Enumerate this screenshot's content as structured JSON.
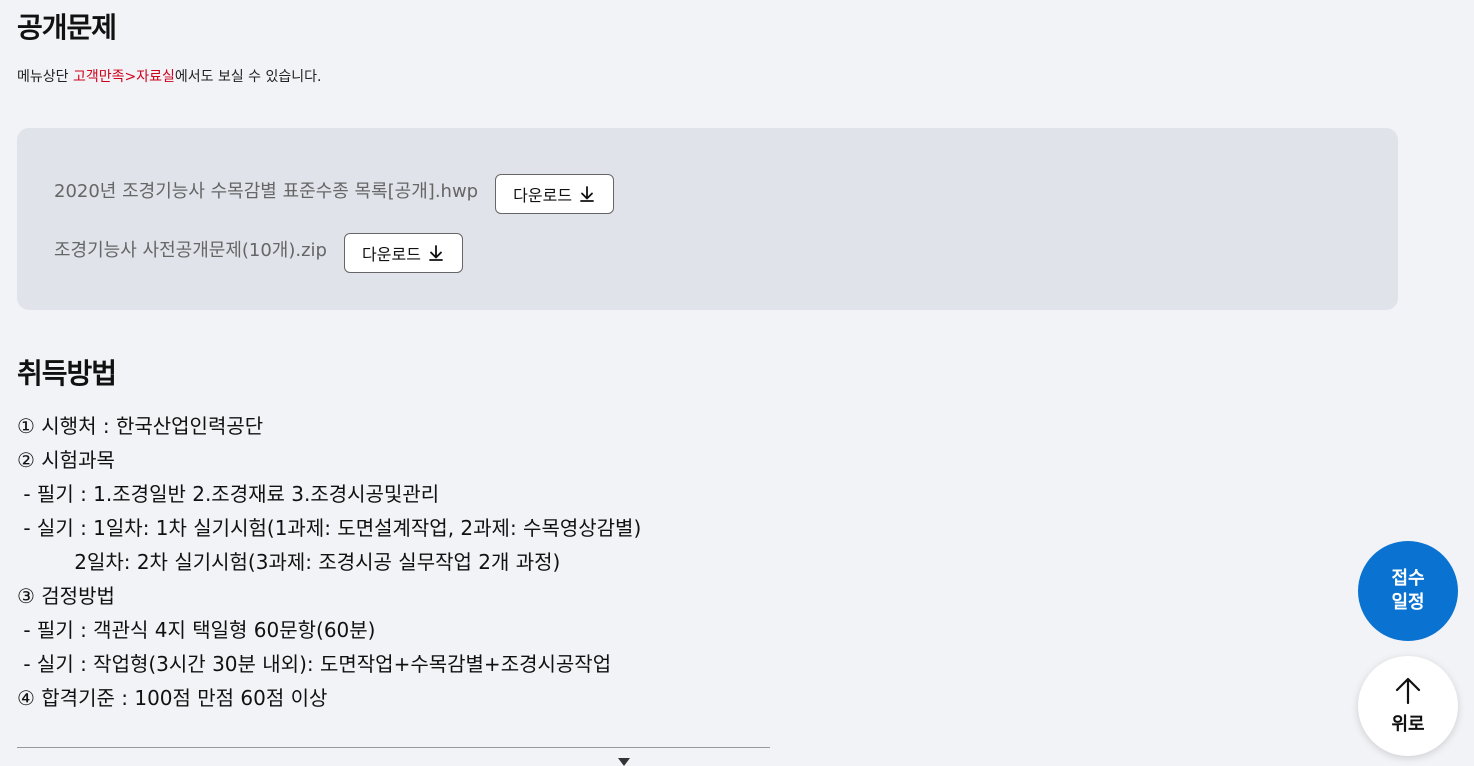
{
  "sections": {
    "public": {
      "title": "공개문제",
      "note_prefix": "메뉴상단 ",
      "note_link": "고객만족>자료실",
      "note_suffix": "에서도 보실 수 있습니다.",
      "files": [
        {
          "name": "2020년 조경기능사 수목감별 표준수종 목록[공개].hwp",
          "button": "다운로드"
        },
        {
          "name": "조경기능사 사전공개문제(10개).zip",
          "button": "다운로드"
        }
      ]
    },
    "acquire": {
      "title": "취득방법",
      "lines": [
        "① 시행처 : 한국산업인력공단",
        "② 시험과목",
        " - 필기 : 1.조경일반 2.조경재료 3.조경시공및관리",
        " - 실기 : 1일차: 1차 실기시험(1과제: 도면설계작업, 2과제: 수목영상감별)",
        "         2일차: 2차 실기시험(3과제: 조경시공 실무작업 2개 과정)",
        "③ 검정방법",
        " - 필기 : 객관식 4지 택일형 60문항(60분)",
        " - 실기 : 작업형(3시간 30분 내외): 도면작업+수목감별+조경시공작업",
        "④ 합격기준 : 100점 만점 60점 이상"
      ]
    }
  },
  "floating": {
    "schedule_line1": "접수",
    "schedule_line2": "일정",
    "top_label": "위로",
    "schedule_color": "#0a72d1"
  },
  "icons": {
    "download": "download-icon",
    "arrow_up": "arrow-up-icon",
    "caret": "caret-down-icon"
  }
}
